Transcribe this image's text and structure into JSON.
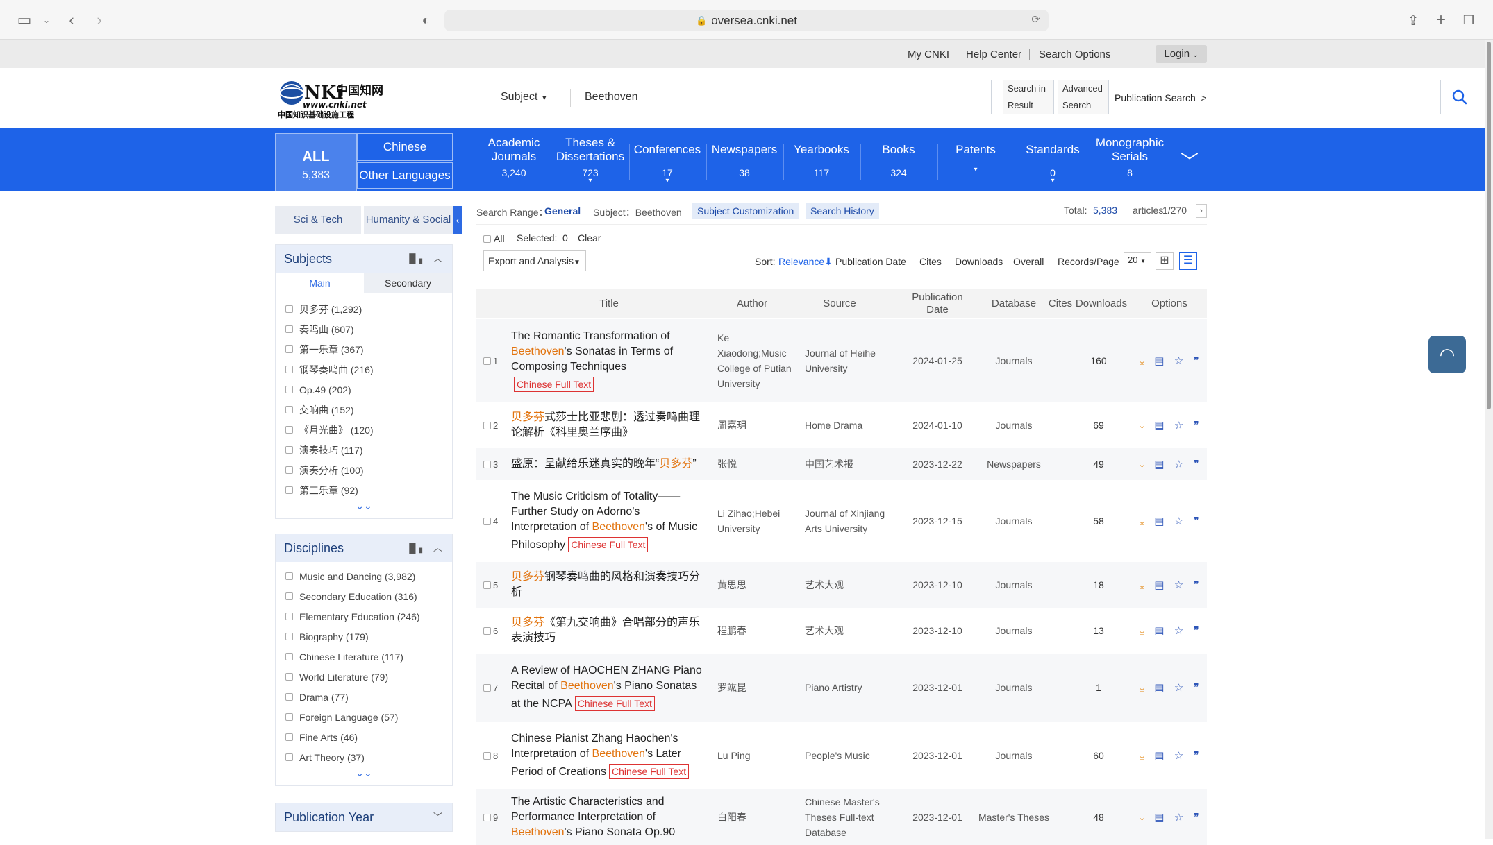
{
  "browser": {
    "url": "oversea.cnki.net"
  },
  "top_links": {
    "my_cnki": "My CNKI",
    "help_center": "Help Center",
    "search_options": "Search Options",
    "login": "Login"
  },
  "search": {
    "field": "Subject",
    "query": "Beethoven",
    "search_in_result_1": "Search in",
    "search_in_result_2": "Result",
    "advanced_1": "Advanced",
    "advanced_2": "Search",
    "publication_search": "Publication Search"
  },
  "nav": {
    "all_label": "ALL",
    "all_count": "5,383",
    "chinese": "Chinese",
    "other_languages": "Other Languages",
    "items": [
      {
        "label": "Academic Journals",
        "count": "3,240",
        "arrow": false
      },
      {
        "label": "Theses & Dissertations",
        "count": "723",
        "arrow": true
      },
      {
        "label": "Conferences",
        "count": "17",
        "arrow": true
      },
      {
        "label": "Newspapers",
        "count": "38",
        "arrow": false
      },
      {
        "label": "Yearbooks",
        "count": "117",
        "arrow": false
      },
      {
        "label": "Books",
        "count": "324",
        "arrow": false
      },
      {
        "label": "Patents",
        "count": "",
        "arrow": true
      },
      {
        "label": "Standards",
        "count": "0",
        "arrow": true
      },
      {
        "label": "Monographic Serials",
        "count": "8",
        "arrow": false
      }
    ]
  },
  "left": {
    "tab_sci": "Sci & Tech",
    "tab_hum": "Humanity & Social",
    "subjects_title": "Subjects",
    "subtab_main": "Main",
    "subtab_secondary": "Secondary",
    "subjects": [
      "贝多芬 (1,292)",
      "奏鸣曲 (607)",
      "第一乐章 (367)",
      "钢琴奏鸣曲 (216)",
      "Op.49 (202)",
      "交响曲 (152)",
      "《月光曲》 (120)",
      "演奏技巧 (117)",
      "演奏分析 (100)",
      "第三乐章 (92)"
    ],
    "disciplines_title": "Disciplines",
    "disciplines": [
      "Music and Dancing (3,982)",
      "Secondary Education (316)",
      "Elementary Education (246)",
      "Biography (179)",
      "Chinese Literature (117)",
      "World Literature (79)",
      "Drama (77)",
      "Foreign Language (57)",
      "Fine Arts (46)",
      "Art Theory (37)"
    ],
    "pub_year_title": "Publication Year"
  },
  "range": {
    "label": "Search Range：",
    "value": "General",
    "subject": "Subject：Beethoven",
    "customization": "Subject Customization",
    "history": "Search History",
    "total_label": "Total:",
    "total": "5,383",
    "articles": "articles",
    "pages": "1/270"
  },
  "select_bar": {
    "all": "All",
    "selected_label": "Selected:",
    "selected_count": "0",
    "clear": "Clear"
  },
  "sort_bar": {
    "export": "Export and Analysis",
    "sort_label": "Sort:",
    "relevance": "Relevance",
    "pub_date": "Publication Date",
    "cites": "Cites",
    "downloads": "Downloads",
    "overall": "Overall",
    "records_label": "Records/Page",
    "records": "20"
  },
  "table_head": {
    "title": "Title",
    "author": "Author",
    "source": "Source",
    "pub_date": "Publication Date",
    "database": "Database",
    "cites": "Cites",
    "downloads": "Downloads",
    "options": "Options"
  },
  "rows": [
    {
      "n": "1",
      "title_parts": [
        "The Romantic Transformation of ",
        "Beethoven",
        "'s Sonatas in Terms of Composing Techniques"
      ],
      "cft": "Chinese Full Text",
      "author": "Ke Xiaodong;Music College of Putian University",
      "source": "Journal of Heihe University",
      "date": "2024-01-25",
      "db": "Journals",
      "dl": "160"
    },
    {
      "n": "2",
      "title_parts": [
        "",
        "贝多芬",
        "式莎士比亚悲剧：透过奏鸣曲理论解析《科里奥兰序曲》"
      ],
      "cft": "",
      "author": "周嘉玥",
      "source": "Home Drama",
      "date": "2024-01-10",
      "db": "Journals",
      "dl": "69"
    },
    {
      "n": "3",
      "title_parts": [
        "盛原：呈献给乐迷真实的晚年“",
        "贝多芬",
        "”"
      ],
      "cft": "",
      "author": "张悦",
      "source": "中国艺术报",
      "date": "2023-12-22",
      "db": "Newspapers",
      "dl": "49"
    },
    {
      "n": "4",
      "title_parts": [
        "The Music Criticism of Totality——Further Study on Adorno's Interpretation of ",
        "Beethoven",
        "'s of Music Philosophy"
      ],
      "cft": "Chinese Full Text",
      "author": "Li Zihao;Hebei University",
      "source": "Journal of Xinjiang Arts University",
      "date": "2023-12-15",
      "db": "Journals",
      "dl": "58"
    },
    {
      "n": "5",
      "title_parts": [
        "",
        "贝多芬",
        "钢琴奏鸣曲的风格和演奏技巧分析"
      ],
      "cft": "",
      "author": "黄思思",
      "source": "艺术大观",
      "date": "2023-12-10",
      "db": "Journals",
      "dl": "18"
    },
    {
      "n": "6",
      "title_parts": [
        "",
        "贝多芬",
        "《第九交响曲》合唱部分的声乐表演技巧"
      ],
      "cft": "",
      "author": "程鹏春",
      "source": "艺术大观",
      "date": "2023-12-10",
      "db": "Journals",
      "dl": "13"
    },
    {
      "n": "7",
      "title_parts": [
        "A Review of HAOCHEN ZHANG Piano Recital of ",
        "Beethoven",
        "'s Piano Sonatas at the NCPA"
      ],
      "cft": "Chinese Full Text",
      "author": "罗竑昆",
      "source": "Piano Artistry",
      "date": "2023-12-01",
      "db": "Journals",
      "dl": "1"
    },
    {
      "n": "8",
      "title_parts": [
        "Chinese Pianist Zhang Haochen's Interpretation of ",
        "Beethoven",
        "'s Later Period of Creations"
      ],
      "cft": "Chinese Full Text",
      "author": "Lu Ping",
      "source": "People's Music",
      "date": "2023-12-01",
      "db": "Journals",
      "dl": "60"
    },
    {
      "n": "9",
      "title_parts": [
        "The Artistic Characteristics and Performance Interpretation of ",
        "Beethoven",
        "'s Piano Sonata Op.90"
      ],
      "cft": "",
      "author": "白阳春",
      "source": "Chinese Master's Theses Full-text Database",
      "date": "2023-12-01",
      "db": "Master's Theses",
      "dl": "48"
    }
  ],
  "colors": {
    "nav_blue": "#1e63e8",
    "highlight_orange": "#e2740f",
    "full_text_red": "#dd3333"
  }
}
